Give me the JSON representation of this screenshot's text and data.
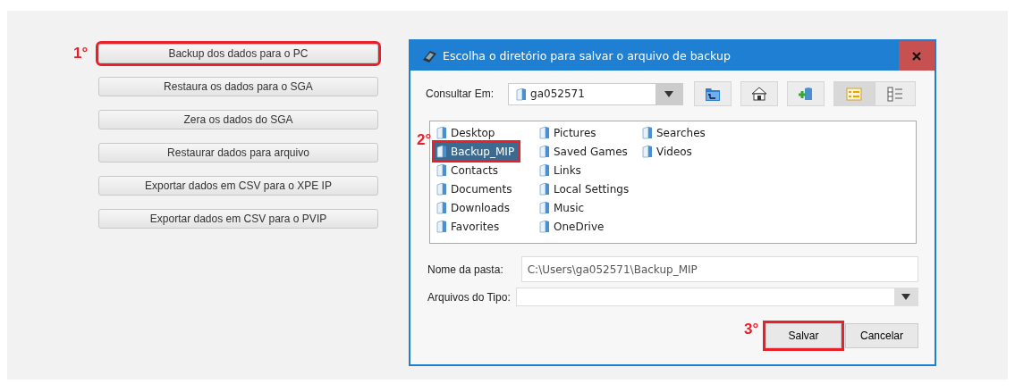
{
  "actions": [
    {
      "label": "Backup dos dados para o PC",
      "highlighted": true,
      "step": "1°"
    },
    {
      "label": "Restaura os dados para o SGA",
      "highlighted": false
    },
    {
      "label": "Zera os dados do SGA",
      "highlighted": false
    },
    {
      "label": "Restaurar dados para arquivo",
      "highlighted": false
    },
    {
      "label": "Exportar dados em CSV para o XPE IP",
      "highlighted": false
    },
    {
      "label": "Exportar dados em CSV para o PVIP",
      "highlighted": false
    }
  ],
  "dialog": {
    "title": "Escolha o diretório para salvar o arquivo de backup",
    "look_in": {
      "label": "Consultar Em:",
      "value": "ga052571"
    },
    "toolbar": [
      {
        "kind": "up",
        "selected": false
      },
      {
        "kind": "home",
        "selected": false
      },
      {
        "kind": "new-folder",
        "selected": false
      },
      {
        "kind": "list-view",
        "selected": true
      },
      {
        "kind": "details-view",
        "selected": false
      }
    ],
    "folders": [
      {
        "name": "Desktop",
        "selected": false,
        "highlighted": false
      },
      {
        "name": "Backup_MIP",
        "selected": true,
        "highlighted": true,
        "step": "2°"
      },
      {
        "name": "Contacts",
        "selected": false,
        "highlighted": false
      },
      {
        "name": "Documents",
        "selected": false,
        "highlighted": false
      },
      {
        "name": "Downloads",
        "selected": false,
        "highlighted": false
      },
      {
        "name": "Favorites",
        "selected": false,
        "highlighted": false
      },
      {
        "name": "Pictures",
        "selected": false,
        "highlighted": false
      },
      {
        "name": "Saved Games",
        "selected": false,
        "highlighted": false
      },
      {
        "name": "Links",
        "selected": false,
        "highlighted": false
      },
      {
        "name": "Local Settings",
        "selected": false,
        "highlighted": false
      },
      {
        "name": "Music",
        "selected": false,
        "highlighted": false
      },
      {
        "name": "OneDrive",
        "selected": false,
        "highlighted": false
      },
      {
        "name": "Searches",
        "selected": false,
        "highlighted": false
      },
      {
        "name": "Videos",
        "selected": false,
        "highlighted": false
      }
    ],
    "folder_name": {
      "label": "Nome da pasta:",
      "value": "C:\\Users\\ga052571\\Backup_MIP"
    },
    "file_type": {
      "label": "Arquivos do Tipo:"
    },
    "buttons": [
      {
        "label": "Salvar",
        "highlighted": true,
        "step": "3°"
      },
      {
        "label": "Cancelar",
        "highlighted": false
      }
    ]
  }
}
